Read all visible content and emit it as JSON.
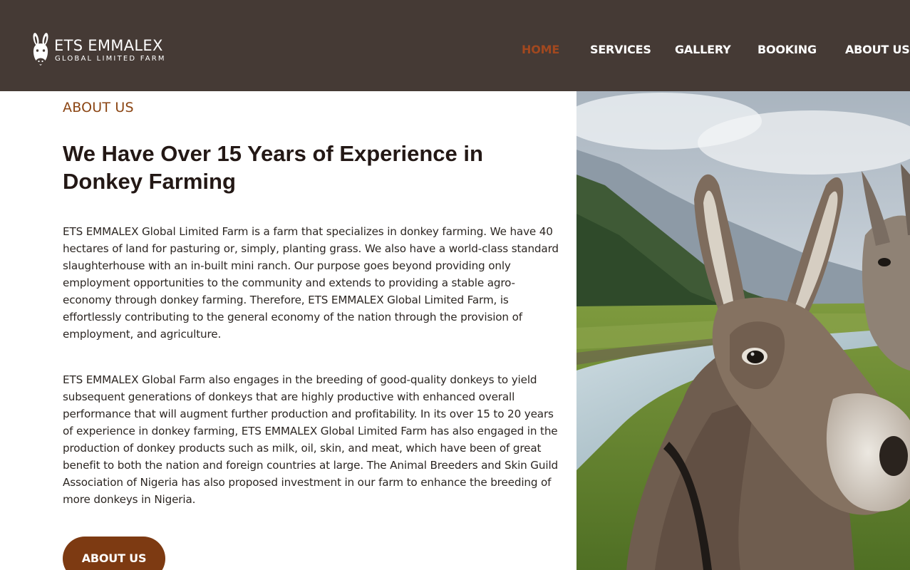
{
  "brand": {
    "title": "ETS EMMALEX",
    "subtitle": "GLOBAL LIMITED FARM",
    "logo_icon": "donkey-head-icon"
  },
  "nav": {
    "items": [
      {
        "label": "HOME",
        "active": true
      },
      {
        "label": "SERVICES",
        "active": false
      },
      {
        "label": "GALLERY",
        "active": false
      },
      {
        "label": "BOOKING",
        "active": false
      },
      {
        "label": "ABOUT US",
        "active": false
      }
    ]
  },
  "about": {
    "eyebrow": "ABOUT US",
    "heading": "We Have Over 15 Years of Experience in Donkey Farming",
    "paragraphs": [
      "ETS EMMALEX Global Limited Farm is a farm that specializes in donkey farming. We have 40 hectares of land for pasturing or, simply, planting grass. We also have a world-class standard slaughterhouse with an in-built mini ranch. Our purpose goes beyond providing only employment opportunities to the community and extends to providing a stable agro-economy through donkey farming. Therefore, ETS EMMALEX Global Limited Farm, is effortlessly contributing to the general economy of the nation through the provision of employment, and agriculture.",
      "ETS EMMALEX Global Farm also engages in the breeding of good-quality donkeys to yield subsequent generations of donkeys that are highly productive with enhanced overall performance that will augment further production and profitability. In its over 15 to 20 years of experience in donkey farming, ETS EMMALEX Global Limited Farm has also engaged in the production of donkey products such as milk, oil, skin, and meat, which have been of great benefit to both the nation and foreign countries at large. The Animal Breeders and Skin Guild Association of Nigeria has also proposed investment in our farm to enhance the breeding of more donkeys in Nigeria."
    ],
    "button_label": "ABOUT US"
  },
  "colors": {
    "header_bg": "#453a35",
    "accent": "#8b4513",
    "nav_active": "#a2481f",
    "button_bg": "#7d3a12"
  }
}
